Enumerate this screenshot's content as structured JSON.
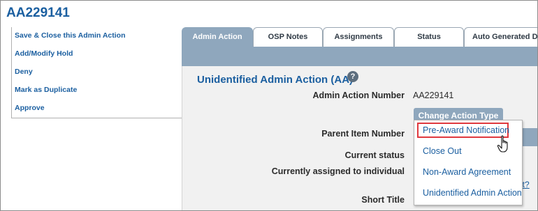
{
  "page": {
    "title": "AA229141"
  },
  "sidebar": {
    "items": [
      {
        "label": "Save & Close this Admin Action"
      },
      {
        "label": "Add/Modify Hold"
      },
      {
        "label": "Deny"
      },
      {
        "label": "Mark as Duplicate"
      },
      {
        "label": "Approve"
      }
    ]
  },
  "tabs": [
    {
      "label": "Admin Action",
      "active": true
    },
    {
      "label": "OSP Notes",
      "active": false
    },
    {
      "label": "Assignments",
      "active": false
    },
    {
      "label": "Status",
      "active": false
    },
    {
      "label": "Auto Generated Doc",
      "active": false
    }
  ],
  "main": {
    "heading": "Unidentified Admin Action (AA)",
    "help_icon": "question-mark-circle",
    "fields": [
      {
        "label": "Admin Action Number",
        "value": "AA229141"
      },
      {
        "label": "Parent Item Number",
        "value": ""
      },
      {
        "label": "Current status",
        "value": ""
      },
      {
        "label": "Currently assigned to individual",
        "value": ""
      },
      {
        "label": "Short Title",
        "value": ""
      }
    ],
    "change_action_label": "Change Action Type",
    "partial_link_text": "nt?"
  },
  "dropdown": {
    "items": [
      {
        "label": "Pre-Award Notification",
        "highlighted": true
      },
      {
        "label": "Close Out",
        "highlighted": false
      },
      {
        "label": "Non-Award Agreement",
        "highlighted": false
      },
      {
        "label": "Unidentified Admin Action",
        "highlighted": false
      }
    ],
    "highlight_color": "#e0393e"
  },
  "colors": {
    "brand_blue": "#1b5fa0",
    "tab_active": "#8fa7bd",
    "content_bg": "#f1f1f1"
  }
}
